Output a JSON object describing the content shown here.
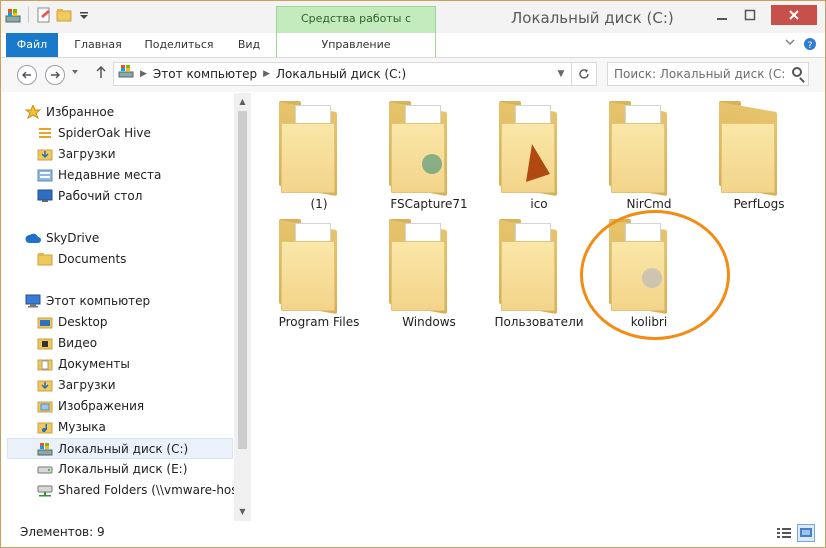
{
  "window": {
    "title": "Локальный диск (C:)",
    "contextual_tab_group": "Средства работы с дисками"
  },
  "ribbon": {
    "tabs": [
      "Файл",
      "Главная",
      "Поделиться",
      "Вид",
      "Управление"
    ]
  },
  "address": {
    "crumbs": [
      "Этот компьютер",
      "Локальный диск (C:)"
    ]
  },
  "search": {
    "placeholder": "Поиск: Локальный диск (C:)"
  },
  "nav": {
    "items": [
      {
        "label": "Избранное",
        "icon": "star-icon"
      },
      {
        "label": "SpiderOak Hive",
        "icon": "spideroak-icon"
      },
      {
        "label": "Загрузки",
        "icon": "downloads-folder-icon"
      },
      {
        "label": "Недавние места",
        "icon": "recent-places-icon"
      },
      {
        "label": "Рабочий стол",
        "icon": "desktop-icon"
      },
      {
        "label": "SkyDrive",
        "icon": "skydrive-cloud-icon"
      },
      {
        "label": "Documents",
        "icon": "folder-icon"
      },
      {
        "label": "Этот компьютер",
        "icon": "computer-icon"
      },
      {
        "label": "Desktop",
        "icon": "folder-icon"
      },
      {
        "label": "Видео",
        "icon": "video-folder-icon"
      },
      {
        "label": "Документы",
        "icon": "documents-folder-icon"
      },
      {
        "label": "Загрузки",
        "icon": "downloads-folder-icon"
      },
      {
        "label": "Изображения",
        "icon": "pictures-folder-icon"
      },
      {
        "label": "Музыка",
        "icon": "music-folder-icon"
      },
      {
        "label": "Локальный диск (C:)",
        "icon": "windows-drive-icon"
      },
      {
        "label": "Локальный диск (E:)",
        "icon": "drive-icon"
      },
      {
        "label": "Shared Folders (\\\\vmware-host) (",
        "icon": "network-drive-icon"
      }
    ],
    "selected": "Локальный диск (C:)"
  },
  "folders": [
    {
      "name": "(1)"
    },
    {
      "name": "FSCapture71"
    },
    {
      "name": "ico"
    },
    {
      "name": "NirCmd"
    },
    {
      "name": "PerfLogs"
    },
    {
      "name": "Program Files"
    },
    {
      "name": "Windows"
    },
    {
      "name": "Пользователи"
    },
    {
      "name": "kolibri"
    }
  ],
  "status": {
    "count": "Элементов: 9"
  },
  "colors": {
    "accent": "#1979ca",
    "contextual": "#c4ebbd",
    "close": "#c7504a",
    "highlight": "#f28c13"
  }
}
